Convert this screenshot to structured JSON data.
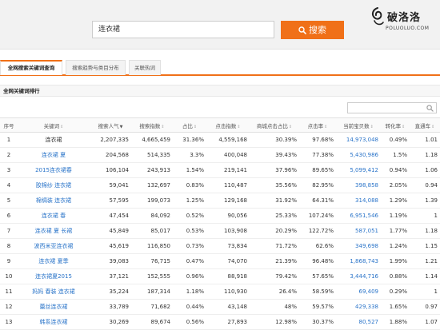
{
  "search": {
    "query": "连衣裙",
    "button_label": "搜索"
  },
  "watermark": {
    "cn": "破洛洛",
    "en": "POLUOLUO.COM"
  },
  "tabs": [
    {
      "label": "全网搜索关键词查询",
      "active": true
    },
    {
      "label": "搜索趋势与类目分布",
      "active": false
    },
    {
      "label": "关联热词",
      "active": false
    }
  ],
  "section_title": "全网关键词排行",
  "columns": [
    {
      "label": "序号",
      "sortable": false,
      "sorted": false
    },
    {
      "label": "关键词",
      "sortable": true,
      "sorted": false
    },
    {
      "label": "搜索人气",
      "sortable": true,
      "sorted": true
    },
    {
      "label": "搜索指数",
      "sortable": true,
      "sorted": false
    },
    {
      "label": "占比",
      "sortable": true,
      "sorted": false
    },
    {
      "label": "点击指数",
      "sortable": true,
      "sorted": false
    },
    {
      "label": "商城点击占比",
      "sortable": true,
      "sorted": false
    },
    {
      "label": "点击率",
      "sortable": true,
      "sorted": false
    },
    {
      "label": "当前宝贝数",
      "sortable": true,
      "sorted": false
    },
    {
      "label": "转化率",
      "sortable": true,
      "sorted": false
    },
    {
      "label": "直通车",
      "sortable": true,
      "sorted": false
    }
  ],
  "rows": [
    [
      "1",
      "连衣裙",
      "2,207,335",
      "4,665,459",
      "31.36%",
      "4,559,168",
      "30.39%",
      "97.68%",
      "14,973,048",
      "0.49%",
      "1.01"
    ],
    [
      "2",
      "连衣裙 夏",
      "204,568",
      "514,335",
      "3.3%",
      "400,048",
      "39.43%",
      "77.38%",
      "5,430,986",
      "1.5%",
      "1.18"
    ],
    [
      "3",
      "2015连衣裙春",
      "106,104",
      "243,913",
      "1.54%",
      "219,141",
      "37.96%",
      "89.65%",
      "5,099,412",
      "0.94%",
      "1.06"
    ],
    [
      "4",
      "胶棉纱 连衣裙",
      "59,041",
      "132,697",
      "0.83%",
      "110,487",
      "35.56%",
      "82.95%",
      "398,858",
      "2.05%",
      "0.94"
    ],
    [
      "5",
      "棉绸装 连衣裙",
      "57,595",
      "199,073",
      "1.25%",
      "129,168",
      "31.92%",
      "64.31%",
      "314,088",
      "1.29%",
      "1.39"
    ],
    [
      "6",
      "连衣裙 春",
      "47,454",
      "84,092",
      "0.52%",
      "90,056",
      "25.33%",
      "107.24%",
      "6,951,546",
      "1.19%",
      "1"
    ],
    [
      "7",
      "连衣裙 夏 长裙",
      "45,849",
      "85,017",
      "0.53%",
      "103,908",
      "20.29%",
      "122.72%",
      "587,051",
      "1.77%",
      "1.18"
    ],
    [
      "8",
      "波西米亚连衣裙",
      "45,619",
      "116,850",
      "0.73%",
      "73,834",
      "71.72%",
      "62.6%",
      "349,698",
      "1.24%",
      "1.15"
    ],
    [
      "9",
      "连衣裙 夏季",
      "39,083",
      "76,715",
      "0.47%",
      "74,070",
      "21.39%",
      "96.48%",
      "1,868,743",
      "1.99%",
      "1.21"
    ],
    [
      "10",
      "连衣裙夏2015",
      "37,121",
      "152,555",
      "0.96%",
      "88,918",
      "79.42%",
      "57.65%",
      "3,444,716",
      "0.88%",
      "1.14"
    ],
    [
      "11",
      "妈妈 春装 连衣裙",
      "35,224",
      "187,314",
      "1.18%",
      "110,930",
      "26.4%",
      "58.59%",
      "69,409",
      "0.29%",
      "1"
    ],
    [
      "12",
      "蕾丝连衣裙",
      "33,789",
      "71,682",
      "0.44%",
      "43,148",
      "48%",
      "59.57%",
      "429,338",
      "1.65%",
      "0.97"
    ],
    [
      "13",
      "韩系连衣裙",
      "30,269",
      "89,674",
      "0.56%",
      "27,893",
      "12.98%",
      "30.37%",
      "80,527",
      "1.88%",
      "1.07"
    ]
  ],
  "colors": {
    "accent": "#f07018",
    "link": "#2a74c9"
  }
}
